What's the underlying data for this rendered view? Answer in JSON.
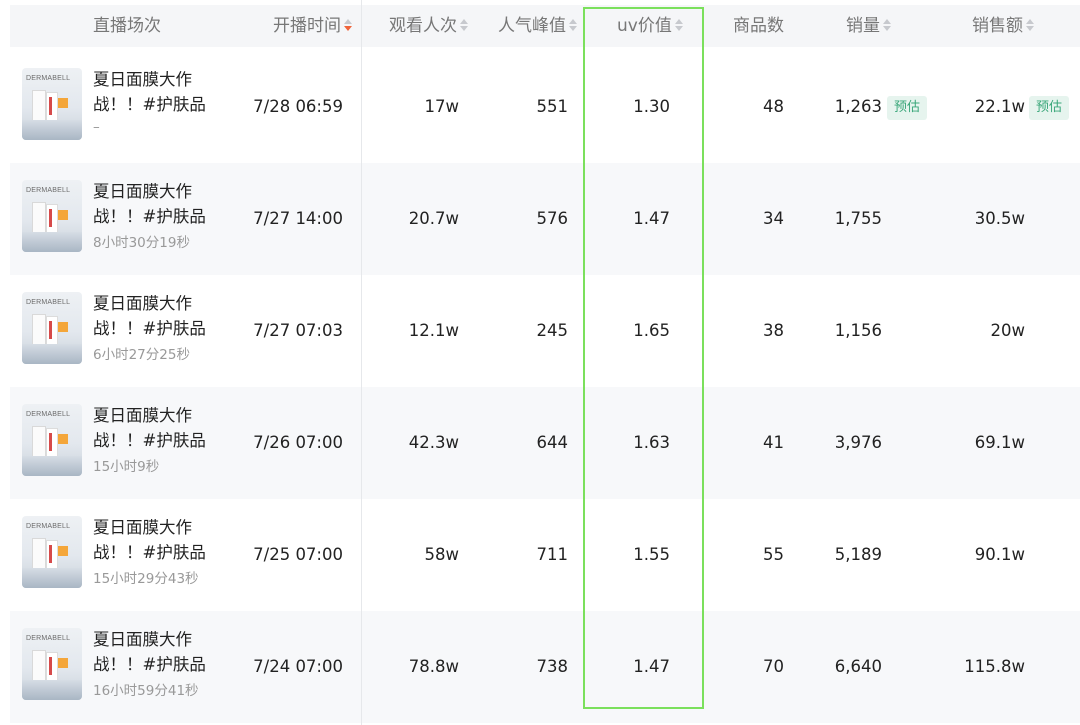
{
  "header": {
    "col_title": "直播场次",
    "col_time": "开播时间",
    "col_views": "观看人次",
    "col_peak": "人气峰值",
    "col_uv": "uv价值",
    "col_products": "商品数",
    "col_sales": "销量",
    "col_revenue": "销售额"
  },
  "thumb": {
    "brand_text": "DERMABELL"
  },
  "badge_label": "预估",
  "rows": [
    {
      "title": "夏日面膜大作战！！#护肤品",
      "duration": "–",
      "time": "7/28 06:59",
      "views": "17w",
      "peak": "551",
      "uv": "1.30",
      "products": "48",
      "sales": "1,263",
      "revenue": "22.1w"
    },
    {
      "title": "夏日面膜大作战！！#护肤品",
      "duration": "8小时30分19秒",
      "time": "7/27 14:00",
      "views": "20.7w",
      "peak": "576",
      "uv": "1.47",
      "products": "34",
      "sales": "1,755",
      "revenue": "30.5w"
    },
    {
      "title": "夏日面膜大作战！！#护肤品",
      "duration": "6小时27分25秒",
      "time": "7/27 07:03",
      "views": "12.1w",
      "peak": "245",
      "uv": "1.65",
      "products": "38",
      "sales": "1,156",
      "revenue": "20w"
    },
    {
      "title": "夏日面膜大作战！！#护肤品",
      "duration": "15小时9秒",
      "time": "7/26 07:00",
      "views": "42.3w",
      "peak": "644",
      "uv": "1.63",
      "products": "41",
      "sales": "3,976",
      "revenue": "69.1w"
    },
    {
      "title": "夏日面膜大作战！！#护肤品",
      "duration": "15小时29分43秒",
      "time": "7/25 07:00",
      "views": "58w",
      "peak": "711",
      "uv": "1.55",
      "products": "55",
      "sales": "5,189",
      "revenue": "90.1w"
    },
    {
      "title": "夏日面膜大作战！！#护肤品",
      "duration": "16小时59分41秒",
      "time": "7/24 07:00",
      "views": "78.8w",
      "peak": "738",
      "uv": "1.47",
      "products": "70",
      "sales": "6,640",
      "revenue": "115.8w"
    }
  ],
  "colors": {
    "highlight": "#7be05c",
    "sort_active": "#f0643a",
    "badge_text": "#3aa77a",
    "badge_bg": "#e6f4ee"
  }
}
